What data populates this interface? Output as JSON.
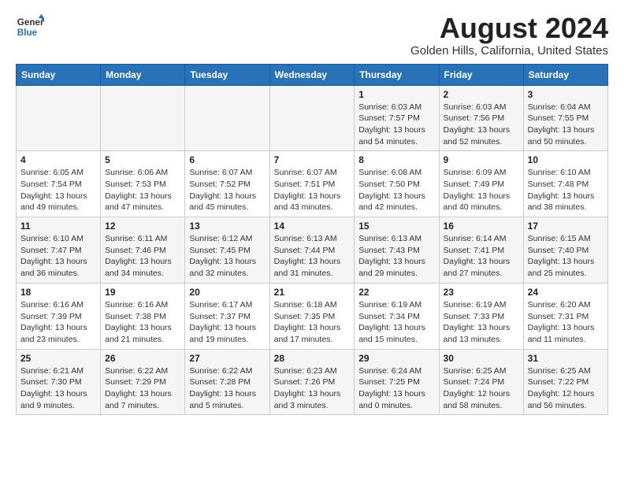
{
  "header": {
    "logo_line1": "General",
    "logo_line2": "Blue",
    "main_title": "August 2024",
    "subtitle": "Golden Hills, California, United States"
  },
  "calendar": {
    "columns": [
      "Sunday",
      "Monday",
      "Tuesday",
      "Wednesday",
      "Thursday",
      "Friday",
      "Saturday"
    ],
    "rows": [
      [
        {
          "day": "",
          "info": ""
        },
        {
          "day": "",
          "info": ""
        },
        {
          "day": "",
          "info": ""
        },
        {
          "day": "",
          "info": ""
        },
        {
          "day": "1",
          "info": "Sunrise: 6:03 AM\nSunset: 7:57 PM\nDaylight: 13 hours\nand 54 minutes."
        },
        {
          "day": "2",
          "info": "Sunrise: 6:03 AM\nSunset: 7:56 PM\nDaylight: 13 hours\nand 52 minutes."
        },
        {
          "day": "3",
          "info": "Sunrise: 6:04 AM\nSunset: 7:55 PM\nDaylight: 13 hours\nand 50 minutes."
        }
      ],
      [
        {
          "day": "4",
          "info": "Sunrise: 6:05 AM\nSunset: 7:54 PM\nDaylight: 13 hours\nand 49 minutes."
        },
        {
          "day": "5",
          "info": "Sunrise: 6:06 AM\nSunset: 7:53 PM\nDaylight: 13 hours\nand 47 minutes."
        },
        {
          "day": "6",
          "info": "Sunrise: 6:07 AM\nSunset: 7:52 PM\nDaylight: 13 hours\nand 45 minutes."
        },
        {
          "day": "7",
          "info": "Sunrise: 6:07 AM\nSunset: 7:51 PM\nDaylight: 13 hours\nand 43 minutes."
        },
        {
          "day": "8",
          "info": "Sunrise: 6:08 AM\nSunset: 7:50 PM\nDaylight: 13 hours\nand 42 minutes."
        },
        {
          "day": "9",
          "info": "Sunrise: 6:09 AM\nSunset: 7:49 PM\nDaylight: 13 hours\nand 40 minutes."
        },
        {
          "day": "10",
          "info": "Sunrise: 6:10 AM\nSunset: 7:48 PM\nDaylight: 13 hours\nand 38 minutes."
        }
      ],
      [
        {
          "day": "11",
          "info": "Sunrise: 6:10 AM\nSunset: 7:47 PM\nDaylight: 13 hours\nand 36 minutes."
        },
        {
          "day": "12",
          "info": "Sunrise: 6:11 AM\nSunset: 7:46 PM\nDaylight: 13 hours\nand 34 minutes."
        },
        {
          "day": "13",
          "info": "Sunrise: 6:12 AM\nSunset: 7:45 PM\nDaylight: 13 hours\nand 32 minutes."
        },
        {
          "day": "14",
          "info": "Sunrise: 6:13 AM\nSunset: 7:44 PM\nDaylight: 13 hours\nand 31 minutes."
        },
        {
          "day": "15",
          "info": "Sunrise: 6:13 AM\nSunset: 7:43 PM\nDaylight: 13 hours\nand 29 minutes."
        },
        {
          "day": "16",
          "info": "Sunrise: 6:14 AM\nSunset: 7:41 PM\nDaylight: 13 hours\nand 27 minutes."
        },
        {
          "day": "17",
          "info": "Sunrise: 6:15 AM\nSunset: 7:40 PM\nDaylight: 13 hours\nand 25 minutes."
        }
      ],
      [
        {
          "day": "18",
          "info": "Sunrise: 6:16 AM\nSunset: 7:39 PM\nDaylight: 13 hours\nand 23 minutes."
        },
        {
          "day": "19",
          "info": "Sunrise: 6:16 AM\nSunset: 7:38 PM\nDaylight: 13 hours\nand 21 minutes."
        },
        {
          "day": "20",
          "info": "Sunrise: 6:17 AM\nSunset: 7:37 PM\nDaylight: 13 hours\nand 19 minutes."
        },
        {
          "day": "21",
          "info": "Sunrise: 6:18 AM\nSunset: 7:35 PM\nDaylight: 13 hours\nand 17 minutes."
        },
        {
          "day": "22",
          "info": "Sunrise: 6:19 AM\nSunset: 7:34 PM\nDaylight: 13 hours\nand 15 minutes."
        },
        {
          "day": "23",
          "info": "Sunrise: 6:19 AM\nSunset: 7:33 PM\nDaylight: 13 hours\nand 13 minutes."
        },
        {
          "day": "24",
          "info": "Sunrise: 6:20 AM\nSunset: 7:31 PM\nDaylight: 13 hours\nand 11 minutes."
        }
      ],
      [
        {
          "day": "25",
          "info": "Sunrise: 6:21 AM\nSunset: 7:30 PM\nDaylight: 13 hours\nand 9 minutes."
        },
        {
          "day": "26",
          "info": "Sunrise: 6:22 AM\nSunset: 7:29 PM\nDaylight: 13 hours\nand 7 minutes."
        },
        {
          "day": "27",
          "info": "Sunrise: 6:22 AM\nSunset: 7:28 PM\nDaylight: 13 hours\nand 5 minutes."
        },
        {
          "day": "28",
          "info": "Sunrise: 6:23 AM\nSunset: 7:26 PM\nDaylight: 13 hours\nand 3 minutes."
        },
        {
          "day": "29",
          "info": "Sunrise: 6:24 AM\nSunset: 7:25 PM\nDaylight: 13 hours\nand 0 minutes."
        },
        {
          "day": "30",
          "info": "Sunrise: 6:25 AM\nSunset: 7:24 PM\nDaylight: 12 hours\nand 58 minutes."
        },
        {
          "day": "31",
          "info": "Sunrise: 6:25 AM\nSunset: 7:22 PM\nDaylight: 12 hours\nand 56 minutes."
        }
      ]
    ]
  }
}
